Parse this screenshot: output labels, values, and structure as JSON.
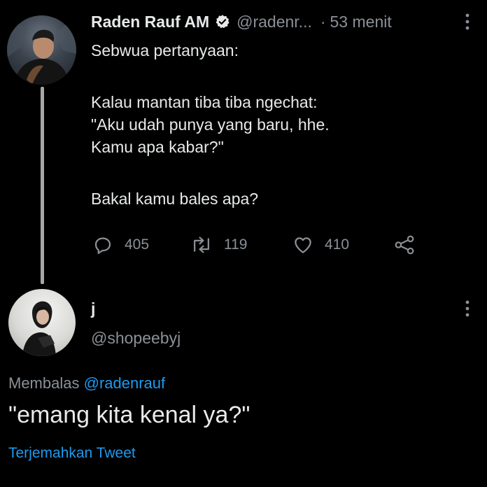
{
  "tweet": {
    "author_name": "Raden Rauf AM",
    "author_handle": "@radenr...",
    "separator": "·",
    "time": "53 menit",
    "lines": [
      "Sebwua pertanyaan:",
      "Kalau mantan tiba tiba ngechat:",
      "\"Aku udah punya yang baru, hhe.",
      "Kamu apa kabar?\"",
      "Bakal kamu bales apa?"
    ],
    "replies_count": "405",
    "retweets_count": "119",
    "likes_count": "410"
  },
  "reply": {
    "author_name": "j",
    "author_handle": "@shopeebyj",
    "replying_prefix": "Membalas",
    "replying_to": "@radenrauf",
    "text": "\"emang kita kenal ya?\"",
    "translate_label": "Terjemahkan Tweet"
  },
  "colors": {
    "background": "#000000",
    "text": "#e7e9ea",
    "muted": "#8b9096",
    "link": "#1d9bf0"
  }
}
